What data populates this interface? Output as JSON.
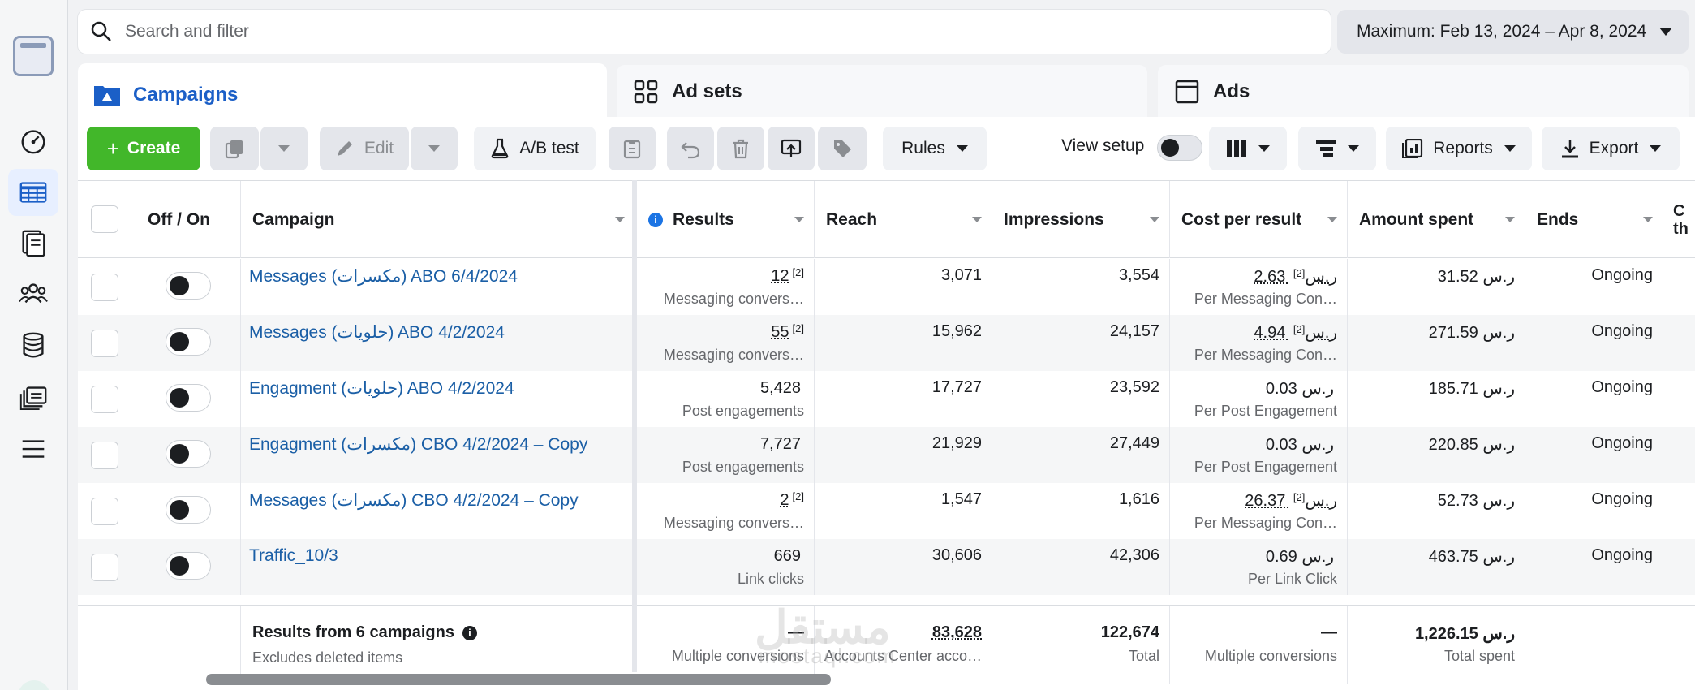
{
  "search": {
    "placeholder": "Search and filter"
  },
  "date_range": "Maximum: Feb 13, 2024 – Apr 8, 2024",
  "tabs": [
    {
      "label": "Campaigns"
    },
    {
      "label": "Ad sets"
    },
    {
      "label": "Ads"
    }
  ],
  "toolbar": {
    "create": "Create",
    "edit": "Edit",
    "ab_test": "A/B test",
    "rules": "Rules",
    "view_setup": "View setup",
    "reports": "Reports",
    "export": "Export"
  },
  "columns": {
    "off_on": "Off / On",
    "campaign": "Campaign",
    "results": "Results",
    "reach": "Reach",
    "impressions": "Impressions",
    "cost_per_result": "Cost per result",
    "amount_spent": "Amount spent",
    "ends": "Ends",
    "next": "C th"
  },
  "rows": [
    {
      "name": "Messages (مكسرات) ABO 6/4/2024",
      "results": "12",
      "results_note": "[2]",
      "results_sub": "Messaging convers…",
      "reach": "3,071",
      "impressions": "3,554",
      "cpr": "2.63 ر.س",
      "cpr_note": "[2]",
      "cpr_sub": "Per Messaging Con…",
      "spent": "31.52 ر.س",
      "ends": "Ongoing"
    },
    {
      "name": "Messages (حلويات) ABO 4/2/2024",
      "results": "55",
      "results_note": "[2]",
      "results_sub": "Messaging convers…",
      "reach": "15,962",
      "impressions": "24,157",
      "cpr": "4.94 ر.س",
      "cpr_note": "[2]",
      "cpr_sub": "Per Messaging Con…",
      "spent": "271.59 ر.س",
      "ends": "Ongoing"
    },
    {
      "name": "Engagment (حلويات) ABO 4/2/2024",
      "results": "5,428",
      "results_note": "",
      "results_sub": "Post engagements",
      "reach": "17,727",
      "impressions": "23,592",
      "cpr": "0.03 ر.س",
      "cpr_note": "",
      "cpr_sub": "Per Post Engagement",
      "spent": "185.71 ر.س",
      "ends": "Ongoing"
    },
    {
      "name": "Engagment (مكسرات) CBO 4/2/2024 – Copy",
      "results": "7,727",
      "results_note": "",
      "results_sub": "Post engagements",
      "reach": "21,929",
      "impressions": "27,449",
      "cpr": "0.03 ر.س",
      "cpr_note": "",
      "cpr_sub": "Per Post Engagement",
      "spent": "220.85 ر.س",
      "ends": "Ongoing"
    },
    {
      "name": "Messages (مكسرات) CBO 4/2/2024 – Copy",
      "results": "2",
      "results_note": "[2]",
      "results_sub": "Messaging convers…",
      "reach": "1,547",
      "impressions": "1,616",
      "cpr": "26.37 ر.س",
      "cpr_note": "[2]",
      "cpr_sub": "Per Messaging Con…",
      "spent": "52.73 ر.س",
      "ends": "Ongoing"
    },
    {
      "name": "Traffic_10/3",
      "results": "669",
      "results_note": "",
      "results_sub": "Link clicks",
      "reach": "30,606",
      "impressions": "42,306",
      "cpr": "0.69 ر.س",
      "cpr_note": "",
      "cpr_sub": "Per Link Click",
      "spent": "463.75 ر.س",
      "ends": "Ongoing"
    }
  ],
  "totals": {
    "label": "Results from 6 campaigns",
    "sublabel": "Excludes deleted items",
    "results": "—",
    "results_sub": "Multiple conversions",
    "reach": "83,628",
    "reach_sub": "Accounts Center acco…",
    "impressions": "122,674",
    "impressions_sub": "Total",
    "cpr": "—",
    "cpr_sub": "Multiple conversions",
    "spent": "1,226.15 ر.س",
    "spent_sub": "Total spent"
  },
  "watermark": {
    "arabic": "مستقل",
    "latin": "mostaql.com"
  }
}
